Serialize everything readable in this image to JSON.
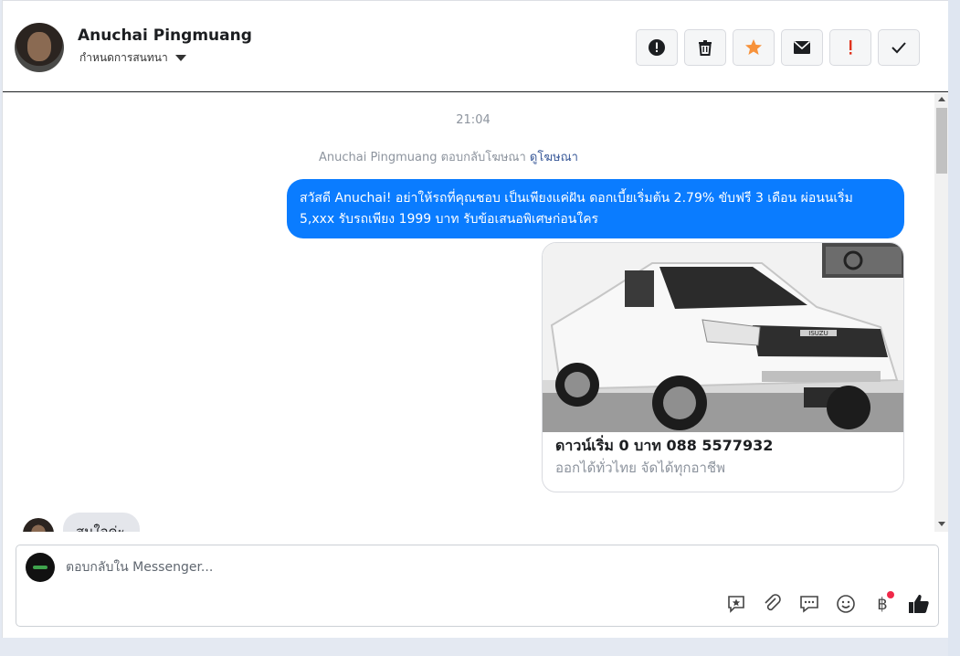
{
  "header": {
    "contact_name": "Anuchai Pingmuang",
    "assign_label": "กำหนดการสนทนา",
    "actions": [
      {
        "icon": "exclamation-circle-icon",
        "color": "#1c1e21"
      },
      {
        "icon": "trash-icon",
        "color": "#1c1e21"
      },
      {
        "icon": "star-icon",
        "color": "#f7923b"
      },
      {
        "icon": "envelope-icon",
        "color": "#1c1e21"
      },
      {
        "icon": "exclamation-icon",
        "color": "#e0321d"
      },
      {
        "icon": "check-icon",
        "color": "#1c1e21"
      }
    ]
  },
  "conversation": {
    "timestamp": "21:04",
    "ad_reply_text": "Anuchai Pingmuang ตอบกลับโฆษณา",
    "ad_link_label": "ดูโฆษณา",
    "outgoing_message": "สวัสดี Anuchai! อย่าให้รถที่คุณชอบ เป็นเพียงแค่ฝัน ดอกเบี้ยเริ่มต้น 2.79% ขับฟรี 3 เดือน ผ่อนนเริ่ม 5,xxx รับรถเพียง 1999 บาท รับข้อเสนอพิเศษก่อนใคร",
    "ad_card": {
      "title": "ดาวน์เริ่ม 0 บาท 088 5577932",
      "subtitle": "ออกได้ทั่วไทย จัดได้ทุกอาชีพ",
      "image_description": "isuzu-pickup-truck-photo",
      "brand_badge": "ISUZU"
    },
    "incoming_message": "สนใจค่ะ"
  },
  "composer": {
    "placeholder": "ตอบกลับใน Messenger...",
    "tools": [
      "saved-reply-icon",
      "attachment-icon",
      "chat-bubble-icon",
      "emoji-icon",
      "baht-icon",
      "like-icon"
    ],
    "baht_symbol": "฿",
    "accent_color": "#0a7cff"
  }
}
